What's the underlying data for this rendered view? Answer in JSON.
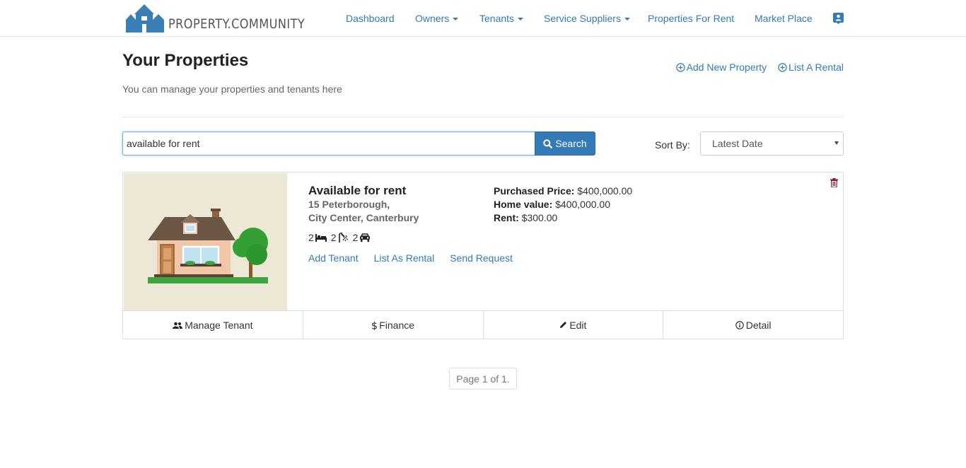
{
  "brand": {
    "name": "PROPERTY.COMMUNITY",
    "color": "#3a80b7"
  },
  "nav": {
    "items": [
      {
        "label": "Dashboard",
        "dropdown": false
      },
      {
        "label": "Owners",
        "dropdown": true
      },
      {
        "label": "Tenants",
        "dropdown": true
      },
      {
        "label": "Service Suppliers",
        "dropdown": true
      },
      {
        "label": "Properties For Rent",
        "dropdown": false
      },
      {
        "label": "Market Place",
        "dropdown": false
      }
    ],
    "profile_icon": "user-badge-icon"
  },
  "header": {
    "title": "Your Properties",
    "subtitle": "You can manage your properties and tenants here",
    "add_property_label": "Add New Property",
    "list_rental_label": "List A Rental"
  },
  "search": {
    "value": "available for rent",
    "button_label": "Search",
    "sort_label": "Sort By:",
    "sort_selected": "Latest Date"
  },
  "property": {
    "title": "Available for rent",
    "address_line1": "15 Peterborough,",
    "address_line2": "City Center, Canterbury",
    "bedrooms": "2",
    "bathrooms": "2",
    "parking": "2",
    "purchased_price_label": "Purchased Price:",
    "purchased_price": "$400,000.00",
    "home_value_label": "Home value:",
    "home_value": "$400,000.00",
    "rent_label": "Rent:",
    "rent": "$300.00",
    "links": {
      "add_tenant": "Add Tenant",
      "list_as_rental": "List As Rental",
      "send_request": "Send Request"
    },
    "footer": {
      "manage_tenant": "Manage Tenant",
      "finance": "Finance",
      "edit": "Edit",
      "detail": "Detail"
    }
  },
  "pagination": {
    "text": "Page 1 of 1."
  },
  "colors": {
    "link": "#337ab7",
    "image_bg": "#ede7d5",
    "trash": "#7a1f3d"
  }
}
